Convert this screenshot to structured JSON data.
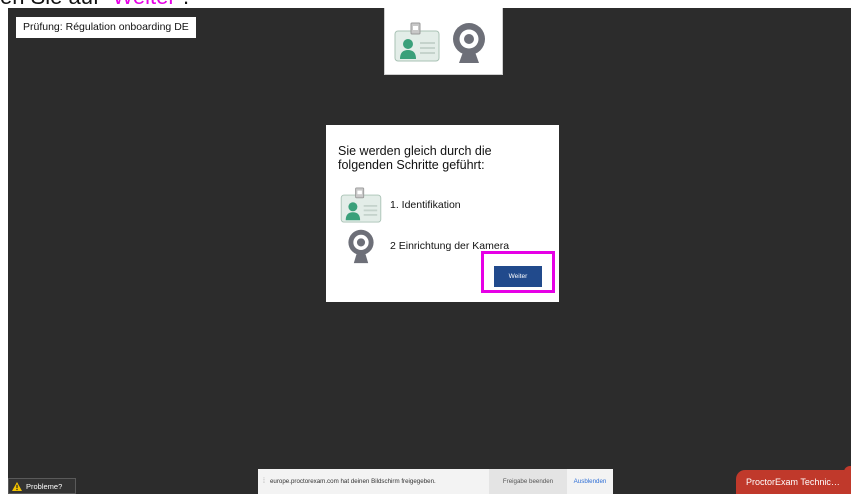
{
  "caption": {
    "text": "en Sie auf “",
    "accent": "Weiter",
    "end": "”."
  },
  "exam_title": "Prüfung: Régulation onboarding DE",
  "dialog": {
    "heading": "Sie werden gleich durch die folgenden Schritte geführt:",
    "steps": [
      {
        "label": "1. Identifikation",
        "icon": "id-card-icon"
      },
      {
        "label": "2 Einrichtung der Kamera",
        "icon": "webcam-icon"
      }
    ],
    "next_button": "Weiter"
  },
  "problems_label": "Probleme?",
  "share_bar": {
    "message": "europe.proctorexam.com hat deinen Bildschirm freigegeben.",
    "stop_label": "Freigabe beenden",
    "hide_label": "Ausblenden"
  },
  "support_label": "ProctorExam Technic…",
  "colors": {
    "background": "#2c2c2c",
    "primary_button": "#214a8c",
    "highlight": "#e600e6",
    "support": "#c0392b",
    "id_card_green": "#3aa07a",
    "webcam_gray": "#6d6f78"
  }
}
